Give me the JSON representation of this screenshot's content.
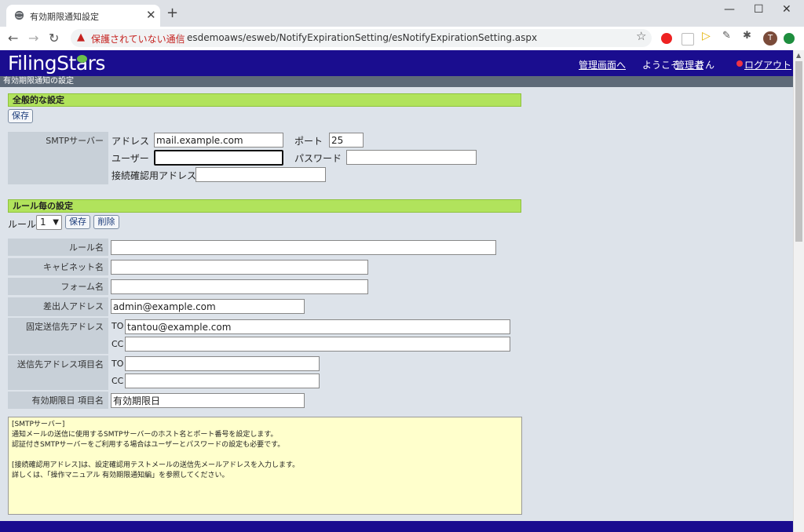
{
  "browser": {
    "tab_title": "有効期限通知設定",
    "insecure_label": "保護されていない通信",
    "url": "esdemoaws/esweb/NotifyExpirationSetting/esNotifyExpirationSetting.aspx",
    "avatar_letter": "T"
  },
  "header": {
    "logo": "FilingStars",
    "admin_link": "管理画面へ",
    "welcome_prefix": "ようこそ",
    "welcome_user": "管理者",
    "welcome_suffix": "さん",
    "logout": "ログアウト"
  },
  "subheader": "有効期限通知の設定",
  "general": {
    "title": "全般的な設定",
    "save_label": "保存",
    "smtp_label": "SMTPサーバー",
    "address_label": "アドレス",
    "address_value": "mail.example.com",
    "port_label": "ポート",
    "port_value": "25",
    "user_label": "ユーザー",
    "user_value": "",
    "password_label": "パスワード",
    "password_value": "",
    "test_address_label": "接続確認用アドレス",
    "test_address_value": ""
  },
  "rules": {
    "title": "ルール毎の設定",
    "rule_label": "ルール",
    "rule_selected": "1",
    "save_label": "保存",
    "delete_label": "削除",
    "rule_name_label": "ルール名",
    "rule_name_value": "",
    "cabinet_label": "キャビネット名",
    "cabinet_value": "",
    "form_label": "フォーム名",
    "form_value": "",
    "sender_label": "差出人アドレス",
    "sender_value": "admin@example.com",
    "fixed_dest_label": "固定送信先アドレス",
    "to_label": "TO",
    "cc_label": "CC",
    "fixed_to_value": "tantou@example.com",
    "fixed_cc_value": "",
    "dest_field_label": "送信先アドレス項目名",
    "dest_to_value": "",
    "dest_cc_value": "",
    "expiry_label": "有効期限日 項目名",
    "expiry_value": "有効期限日"
  },
  "help": {
    "lines": [
      "[SMTPサーバー]",
      "通知メールの送信に使用するSMTPサーバーのホスト名とポート番号を設定します。",
      "認証付きSMTPサーバーをご利用する場合はユーザーとパスワードの設定も必要です。",
      "",
      "[接続確認用アドレス]は、設定確認用テストメールの送信先メールアドレスを入力します。",
      "詳しくは、「操作マニュアル 有効期限通知編」を参照してください。"
    ]
  }
}
